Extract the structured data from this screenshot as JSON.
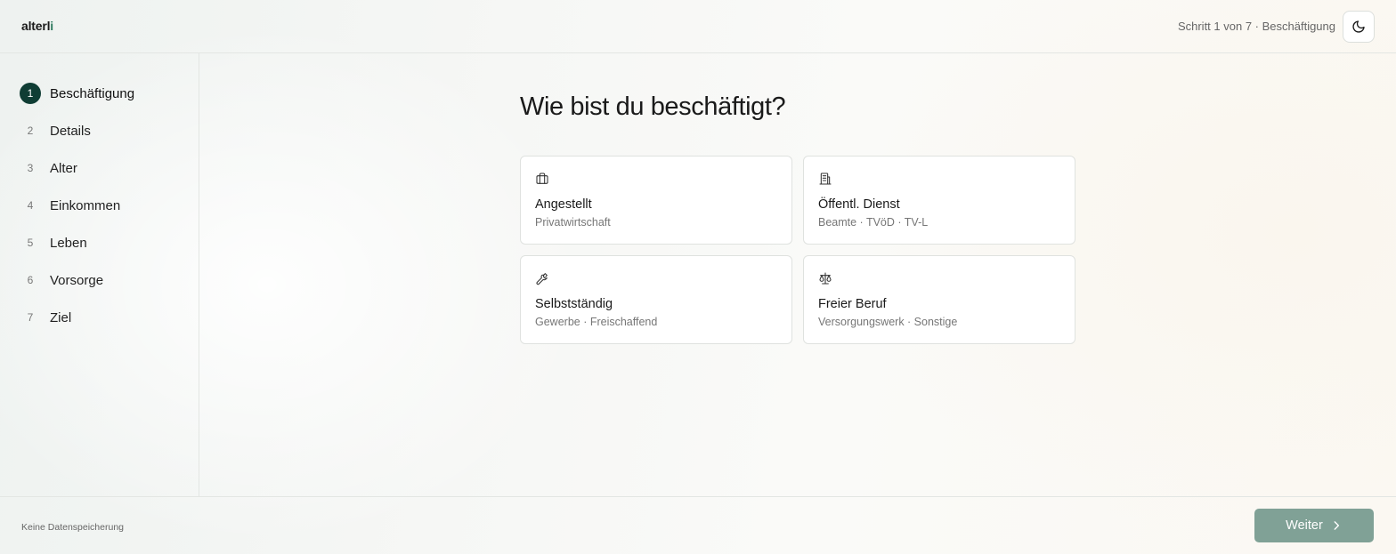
{
  "header": {
    "logo_main": "alterl",
    "logo_accent": "i",
    "step_status": "Schritt 1 von 7 · Beschäftigung",
    "theme_toggle_icon": "moon-icon"
  },
  "sidebar": {
    "items": [
      {
        "number": "1",
        "label": "Beschäftigung",
        "active": true
      },
      {
        "number": "2",
        "label": "Details",
        "active": false
      },
      {
        "number": "3",
        "label": "Alter",
        "active": false
      },
      {
        "number": "4",
        "label": "Einkommen",
        "active": false
      },
      {
        "number": "5",
        "label": "Leben",
        "active": false
      },
      {
        "number": "6",
        "label": "Vorsorge",
        "active": false
      },
      {
        "number": "7",
        "label": "Ziel",
        "active": false
      }
    ]
  },
  "main": {
    "title": "Wie bist du beschäftigt?",
    "options": [
      {
        "icon": "briefcase-icon",
        "title": "Angestellt",
        "subtitle": "Privatwirtschaft"
      },
      {
        "icon": "building-icon",
        "title": "Öffentl. Dienst",
        "subtitle": "Beamte · TVöD · TV-L"
      },
      {
        "icon": "wrench-icon",
        "title": "Selbstständig",
        "subtitle": "Gewerbe · Freischaffend"
      },
      {
        "icon": "scales-icon",
        "title": "Freier Beruf",
        "subtitle": "Versorgungswerk · Sonstige"
      }
    ]
  },
  "footer": {
    "note": "Keine Datenspeicherung",
    "next_label": "Weiter",
    "next_icon": "chevron-right-icon"
  },
  "colors": {
    "accent_dark": "#0f3d34",
    "button_disabled": "#80a196",
    "logo_accent": "#2f7a5f"
  }
}
